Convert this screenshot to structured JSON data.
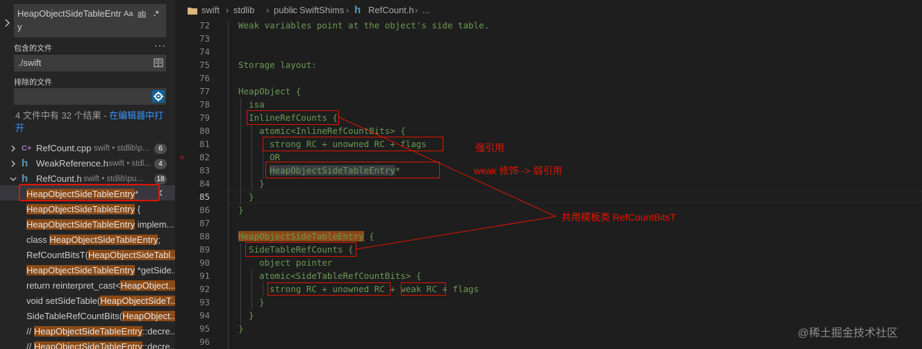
{
  "search": {
    "query": "HeapObjectSideTableEntry",
    "opt_case": "Aa",
    "opt_word": "ab",
    "opt_regex": ".*"
  },
  "include": {
    "label": "包含的文件",
    "value": "./swift"
  },
  "exclude": {
    "label": "排除的文件",
    "value": ""
  },
  "summary": {
    "text": "4 文件中有 32 个结果 - ",
    "link": "在编辑器中打开"
  },
  "files": [
    {
      "icon": "C+",
      "name": "RefCount.cpp",
      "path": "swift • stdlib\\p...",
      "count": "6"
    },
    {
      "icon": "h",
      "name": "WeakReference.h",
      "path": "swift • stdl...",
      "count": "4"
    },
    {
      "icon": "h",
      "name": "RefCount.h",
      "path": "swift • stdlib\\pu...",
      "count": "18"
    }
  ],
  "matches": [
    {
      "pre": "",
      "hl": "HeapObjectSideTableEntry",
      "post": "*"
    },
    {
      "pre": "",
      "hl": "HeapObjectSideTableEntry",
      "post": " {"
    },
    {
      "pre": "",
      "hl": "HeapObjectSideTableEntry",
      "post": " implem..."
    },
    {
      "pre": "class ",
      "hl": "HeapObjectSideTableEntry",
      "post": ";"
    },
    {
      "pre": "RefCountBitsT(",
      "hl": "HeapObjectSideTabl...",
      "post": ""
    },
    {
      "pre": "",
      "hl": "HeapObjectSideTableEntry",
      "post": " *getSide..."
    },
    {
      "pre": "return reinterpret_cast<",
      "hl": "HeapObject...",
      "post": ""
    },
    {
      "pre": "void setSideTable(",
      "hl": "HeapObjectSideT...",
      "post": ""
    },
    {
      "pre": "SideTableRefCountBits(",
      "hl": "HeapObject...",
      "post": ""
    },
    {
      "pre": "// ",
      "hl": "HeapObjectSideTableEntry",
      "post": "::decre..."
    },
    {
      "pre": "// ",
      "hl": "HeapObjectSideTableEntry",
      "post": "::decre..."
    }
  ],
  "breadcrumb": [
    "swift",
    "stdlib",
    "public",
    "SwiftShims",
    "RefCount.h",
    "..."
  ],
  "code": [
    {
      "ln": "72",
      "pre": "Weak variables point at the object's side table.",
      "hl": "",
      "post": ""
    },
    {
      "ln": "73",
      "pre": "",
      "hl": "",
      "post": ""
    },
    {
      "ln": "74",
      "pre": "",
      "hl": "",
      "post": ""
    },
    {
      "ln": "75",
      "pre": "Storage layout:",
      "hl": "",
      "post": ""
    },
    {
      "ln": "76",
      "pre": "",
      "hl": "",
      "post": ""
    },
    {
      "ln": "77",
      "pre": "HeapObject {",
      "hl": "",
      "post": ""
    },
    {
      "ln": "78",
      "pre": "  isa",
      "hl": "",
      "post": ""
    },
    {
      "ln": "79",
      "pre": "  InlineRefCounts {",
      "hl": "",
      "post": ""
    },
    {
      "ln": "80",
      "pre": "    atomic<InlineRefCountBits> {",
      "hl": "",
      "post": ""
    },
    {
      "ln": "81",
      "pre": "      strong RC + unowned RC + flags",
      "hl": "",
      "post": ""
    },
    {
      "ln": "82",
      "pre": "      OR",
      "hl": "",
      "post": ""
    },
    {
      "ln": "83",
      "pre": "      ",
      "hl": "HeapObjectSideTableEntry",
      "post": "*"
    },
    {
      "ln": "84",
      "pre": "    }",
      "hl": "",
      "post": ""
    },
    {
      "ln": "85",
      "pre": "  }",
      "hl": "",
      "post": ""
    },
    {
      "ln": "86",
      "pre": "}",
      "hl": "",
      "post": ""
    },
    {
      "ln": "87",
      "pre": "",
      "hl": "",
      "post": ""
    },
    {
      "ln": "88",
      "pre": "",
      "hl": "HeapObjectSideTableEntry",
      "post": " {"
    },
    {
      "ln": "89",
      "pre": "  SideTableRefCounts {",
      "hl": "",
      "post": ""
    },
    {
      "ln": "90",
      "pre": "    object pointer",
      "hl": "",
      "post": ""
    },
    {
      "ln": "91",
      "pre": "    atomic<SideTableRefCountBits> {",
      "hl": "",
      "post": ""
    },
    {
      "ln": "92",
      "pre": "      strong RC + unowned RC + weak RC + flags",
      "hl": "",
      "post": ""
    },
    {
      "ln": "93",
      "pre": "    }",
      "hl": "",
      "post": ""
    },
    {
      "ln": "94",
      "pre": "  }",
      "hl": "",
      "post": ""
    },
    {
      "ln": "95",
      "pre": "}",
      "hl": "",
      "post": ""
    },
    {
      "ln": "96",
      "pre": "",
      "hl": "",
      "post": ""
    }
  ],
  "annotations": {
    "strong": "强引用",
    "weak": "weak 修饰 -> 弱引用",
    "shared": "共用模板类 RefCountBitsT"
  },
  "watermark": "@稀土掘金技术社区",
  "colors": {
    "annotation": "#e51400",
    "match_highlight": "#8b4a16",
    "comment": "#6a9955"
  }
}
